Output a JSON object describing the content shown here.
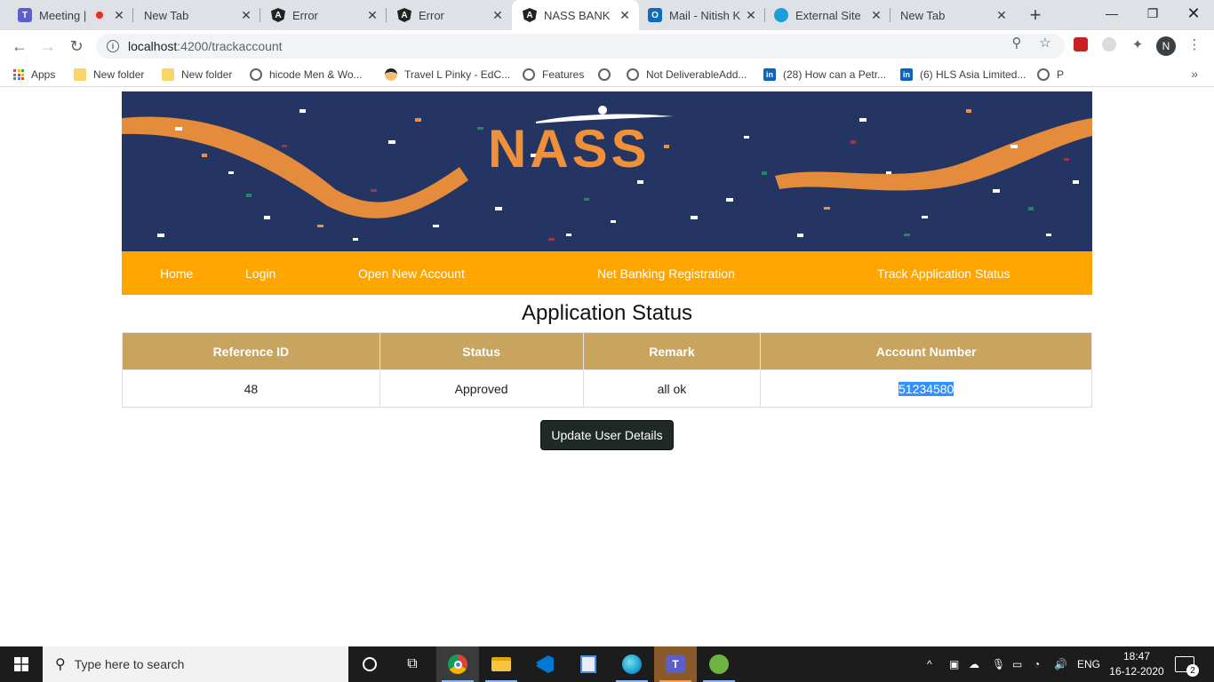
{
  "browser": {
    "tabs": [
      {
        "label": "Meeting |",
        "favicon": "teams-icon",
        "color": "#5b5fc7",
        "has_recording": true
      },
      {
        "label": "New Tab",
        "favicon": "",
        "color": ""
      },
      {
        "label": "Error",
        "favicon": "angular-icon",
        "color": "#222"
      },
      {
        "label": "Error",
        "favicon": "angular-icon",
        "color": "#222"
      },
      {
        "label": "NASS BANK",
        "favicon": "angular-icon",
        "color": "#222",
        "active": true
      },
      {
        "label": "Mail - Nitish K",
        "favicon": "outlook-icon",
        "color": "#0f6cbd"
      },
      {
        "label": "External Site",
        "favicon": "globe-icon",
        "color": "#1a9fd9"
      },
      {
        "label": "New Tab",
        "favicon": "",
        "color": ""
      }
    ],
    "new_tab_symbol": "+",
    "url_host": "localhost",
    "url_path": ":4200/trackaccount",
    "profile_initial": "N",
    "bookmarks": [
      {
        "label": "Apps",
        "icon": "apps"
      },
      {
        "label": "New folder",
        "icon": "folder"
      },
      {
        "label": "New folder",
        "icon": "folder"
      },
      {
        "label": "hicode Men & Wo...",
        "icon": "globe"
      },
      {
        "label": "Travel L Pinky - EdC...",
        "icon": "face"
      },
      {
        "label": "Features",
        "icon": "globe"
      },
      {
        "label": "",
        "icon": "globe"
      },
      {
        "label": "Not DeliverableAdd...",
        "icon": "globe"
      },
      {
        "label": "(28) How can a Petr...",
        "icon": "li"
      },
      {
        "label": "(6) HLS Asia Limited...",
        "icon": "li"
      },
      {
        "label": "P",
        "icon": "globe"
      }
    ],
    "bookmarks_more": "»"
  },
  "site": {
    "logo_text": "NASS",
    "nav": [
      "Home",
      "Login",
      "Open New Account",
      "Net Banking Registration",
      "Track Application Status"
    ],
    "page_title": "Application Status",
    "table": {
      "headers": [
        "Reference ID",
        "Status",
        "Remark",
        "Account Number"
      ],
      "rows": [
        [
          "48",
          "Approved",
          "all ok",
          "51234580"
        ]
      ]
    },
    "update_button": "Update User Details",
    "colors": {
      "banner_bg": "#243563",
      "nav_bg": "#ffa500",
      "table_header_bg": "#c9a45f",
      "button_bg": "#1f2a27"
    }
  },
  "taskbar": {
    "search_placeholder": "Type here to search",
    "language": "ENG",
    "time": "18:47",
    "date": "16-12-2020",
    "notification_count": "2"
  }
}
